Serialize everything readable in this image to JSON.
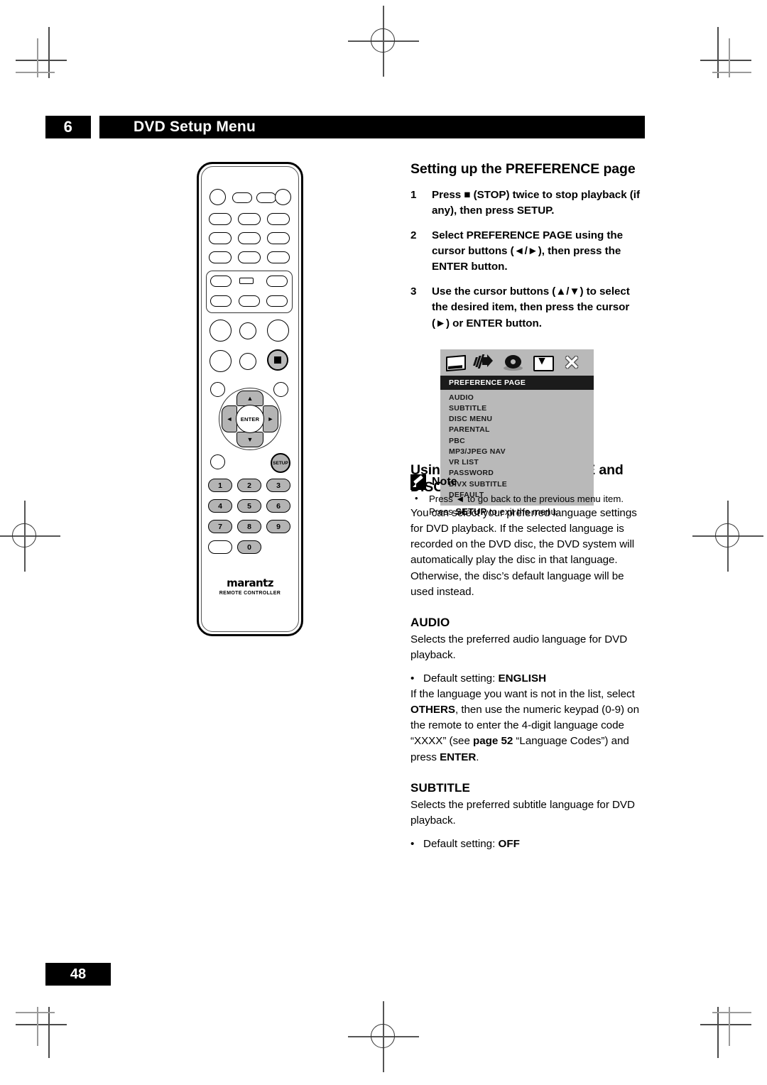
{
  "header": {
    "chapter_number": "6",
    "chapter_title": "DVD Setup Menu"
  },
  "footer": {
    "page_number": "48"
  },
  "sections": {
    "preference": {
      "heading": "Setting up the PREFERENCE page",
      "steps": [
        {
          "number": "1",
          "text": "Press ■ (STOP) twice to stop playback (if any), then press SETUP."
        },
        {
          "number": "2",
          "text": "Select PREFERENCE PAGE using the cursor buttons (◄/►), then press the ENTER button."
        },
        {
          "number": "3",
          "text": "Use the cursor buttons (▲/▼) to select the desired item, then press the cursor (►) or ENTER button."
        }
      ]
    },
    "note": {
      "title": "Note",
      "bullet": "•",
      "line1": "Press ◄ to go back to the previous menu item.",
      "line2_prefix": "Press ",
      "line2_bold": "SETUP",
      "line2_suffix": " to exit the menu."
    },
    "language": {
      "heading": "Using the AUDIO, SUBTITLE and DISC MENU language",
      "body": "You can select your preferred language settings for DVD playback. If the selected language is recorded on the DVD disc, the DVD system will automatically play the disc in that language. Otherwise, the disc’s default language will be used instead."
    },
    "audio": {
      "heading": "AUDIO",
      "body": "Selects the preferred audio language for DVD playback.",
      "bullet": "•",
      "default_label": "Default setting: ",
      "default_value": "ENGLISH",
      "note_1": "If the language you want is not in the list, select ",
      "note_bold_1": "OTHERS",
      "note_2": ", then use the numeric keypad (0-9) on the remote to enter the 4-digit language code “XXXX” (see ",
      "note_bold_2": "page 52",
      "note_3": " “Language Codes”) and press ",
      "note_bold_3": "ENTER",
      "note_4": "."
    },
    "subtitle": {
      "heading": "SUBTITLE",
      "body": "Selects the preferred subtitle language for DVD playback.",
      "bullet": "•",
      "default_label": "Default setting: ",
      "default_value": "OFF"
    }
  },
  "osd": {
    "icons": [
      "monitor-icon",
      "speaker-icon",
      "disc-icon",
      "preference-icon",
      "close-icon"
    ],
    "close_glyph": "✕",
    "page_title": "PREFERENCE PAGE",
    "items": [
      "AUDIO",
      "SUBTITLE",
      "DISC MENU",
      "PARENTAL",
      "PBC",
      "MP3/JPEG NAV",
      "VR LIST",
      "PASSWORD",
      "DIVX SUBTITLE",
      "DEFAULT"
    ],
    "bg_color": "#b9b9b9",
    "header_color": "#1b1b1b"
  },
  "remote": {
    "brand": "marantz",
    "subtitle": "REMOTE CONTROLLER",
    "enter_label": "ENTER",
    "setup_label": "SETUP",
    "cursor_up": "▲",
    "cursor_down": "▼",
    "cursor_left": "◄",
    "cursor_right": "►",
    "numeric_keys": [
      "1",
      "2",
      "3",
      "4",
      "5",
      "6",
      "7",
      "8",
      "9",
      "0"
    ]
  }
}
